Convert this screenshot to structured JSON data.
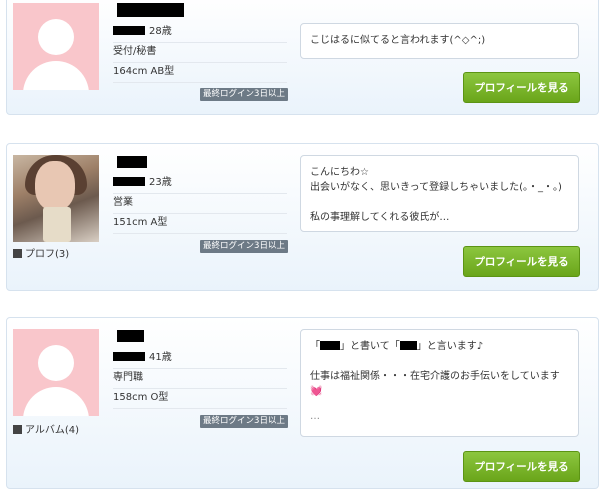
{
  "profiles": [
    {
      "age": "28歳",
      "job": "受付/秘書",
      "body": "164cm  AB型",
      "login": "最終ログイン3日以上",
      "message": "こじはるに似てると言われます(^◇^;)",
      "button": "プロフィールを見る",
      "media": ""
    },
    {
      "age": "23歳",
      "job": "営業",
      "body": "151cm  A型",
      "login": "最終ログイン3日以上",
      "message": "こんにちわ☆\n出会いがなく、思いきって登録しちゃいました(。・_・。)\n\n私の事理解してくれる彼氏が…",
      "button": "プロフィールを見る",
      "media": "プロフ(3)"
    },
    {
      "age": "41歳",
      "job": "専門職",
      "body": "158cm  O型",
      "login": "最終ログイン3日以上",
      "message_line1_a": "「",
      "message_line1_b": "」と書いて「",
      "message_line1_c": "」と言います♪",
      "message_rest": "仕事は福祉関係・・・在宅介護のお手伝いをしています💓",
      "message_tail": "…",
      "button": "プロフィールを見る",
      "media": "アルバム(4)"
    }
  ]
}
